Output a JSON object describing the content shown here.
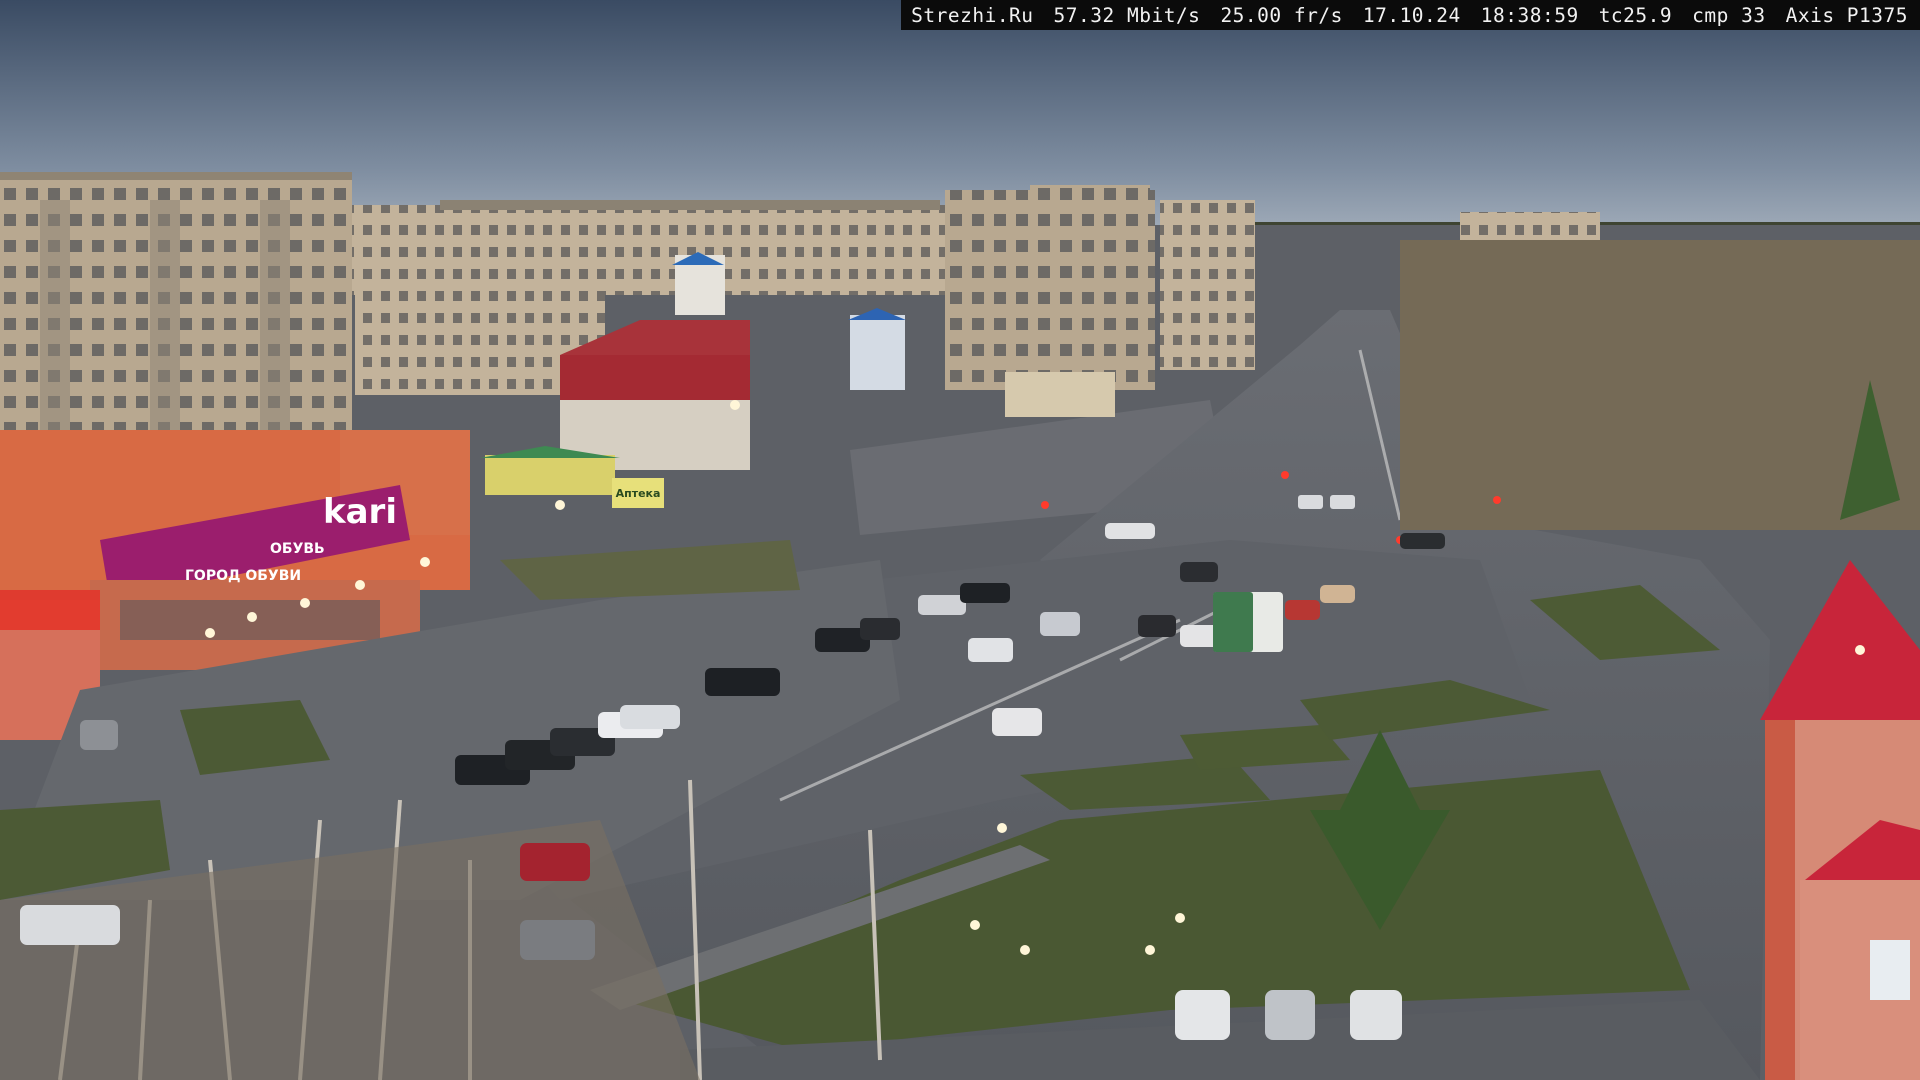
{
  "overlay": {
    "site": "Strezhi.Ru",
    "bitrate": "57.32 Mbit/s",
    "framerate": "25.00 fr/s",
    "date": "17.10.24",
    "time": "18:38:59",
    "tc": "tc25.9",
    "cmp": "cmp 33",
    "camera": "Axis P1375"
  },
  "signs": {
    "store_brand": "kari",
    "store_tagline": "ГОРОД ОБУВИ",
    "store_promo": "ОБУВЬ",
    "kiosk": "Аптека"
  },
  "colors": {
    "sky_top": "#3d4e66",
    "sky_horizon": "#9aa7b6",
    "asphalt": "#5d6066",
    "grass": "#4c5a35",
    "brick": "#b9a893",
    "store_orange": "#d86a44",
    "store_magenta": "#9b1e6d",
    "roof_red": "#c8253a"
  }
}
